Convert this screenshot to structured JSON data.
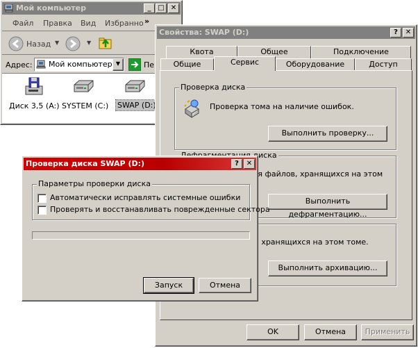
{
  "explorer": {
    "title": "Мой компьютер",
    "menu": [
      "Файл",
      "Правка",
      "Вид",
      "Избранно"
    ],
    "menu_more": "»",
    "back_label": "Назад",
    "address_label": "Адрес:",
    "address_value": "Мой компьютер",
    "go_label": "Пер",
    "drives": [
      {
        "label": "Диск 3,5 (A:)"
      },
      {
        "label": "SYSTEM (C:)"
      },
      {
        "label": "SWAP (D:)"
      }
    ]
  },
  "props": {
    "title": "Свойства: SWAP (D:)",
    "tabs_row1": [
      "Квота",
      "Общее",
      "Подключение"
    ],
    "tabs_row2": [
      "Общие",
      "Сервис",
      "Оборудование",
      "Доступ"
    ],
    "check_group": "Проверка диска",
    "check_text": "Проверка тома на наличие ошибок.",
    "check_button": "Выполнить проверку...",
    "defrag_group": "Дефрагментация диска",
    "defrag_text": "ация файлов, хранящихся на этом",
    "defrag_button": "Выполнить дефрагментацию...",
    "backup_text": "ilов, хранящихся на этом томе.",
    "backup_button": "Выполнить архивацию...",
    "ok": "OK",
    "cancel": "Отмена",
    "apply": "Применить"
  },
  "dialog": {
    "title": "Проверка диска SWAP (D:)",
    "group": "Параметры проверки диска",
    "opt1": "Автоматически исправлять системные ошибки",
    "opt2": "Проверять и восстанавливать поврежденные сектора",
    "progress": 0,
    "start": "Запуск",
    "cancel": "Отмена"
  },
  "title_buttons": {
    "help": "?",
    "close": "✕",
    "min": "_",
    "max": "□"
  }
}
